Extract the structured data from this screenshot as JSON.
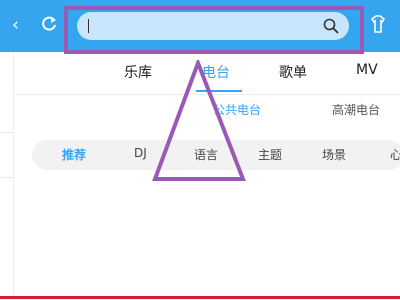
{
  "colors": {
    "header_bg": "#36a5f0",
    "search_bg": "#c8e6fb",
    "accent": "#36a5f0",
    "annotation": "#9b59b6",
    "bottom_bar": "#d81e28"
  },
  "header": {
    "back_icon": "chevron-left-icon",
    "back_glyph": "‹",
    "refresh_icon": "refresh-icon",
    "search": {
      "value": "",
      "placeholder": "",
      "icon": "search-icon"
    },
    "skin_icon": "skin-icon"
  },
  "main_tabs": [
    {
      "label": "乐库",
      "active": false
    },
    {
      "label": "电台",
      "active": true
    },
    {
      "label": "歌单",
      "active": false
    },
    {
      "label": "MV",
      "active": false
    }
  ],
  "sub_tabs": [
    {
      "label": "公共电台",
      "active": true
    },
    {
      "label": "高潮电台",
      "active": false
    }
  ],
  "categories": [
    {
      "label": "推荐",
      "active": true
    },
    {
      "label": "DJ",
      "active": false
    },
    {
      "label": "语言",
      "active": false
    },
    {
      "label": "主题",
      "active": false
    },
    {
      "label": "场景",
      "active": false
    },
    {
      "label": "心",
      "active": false
    }
  ]
}
